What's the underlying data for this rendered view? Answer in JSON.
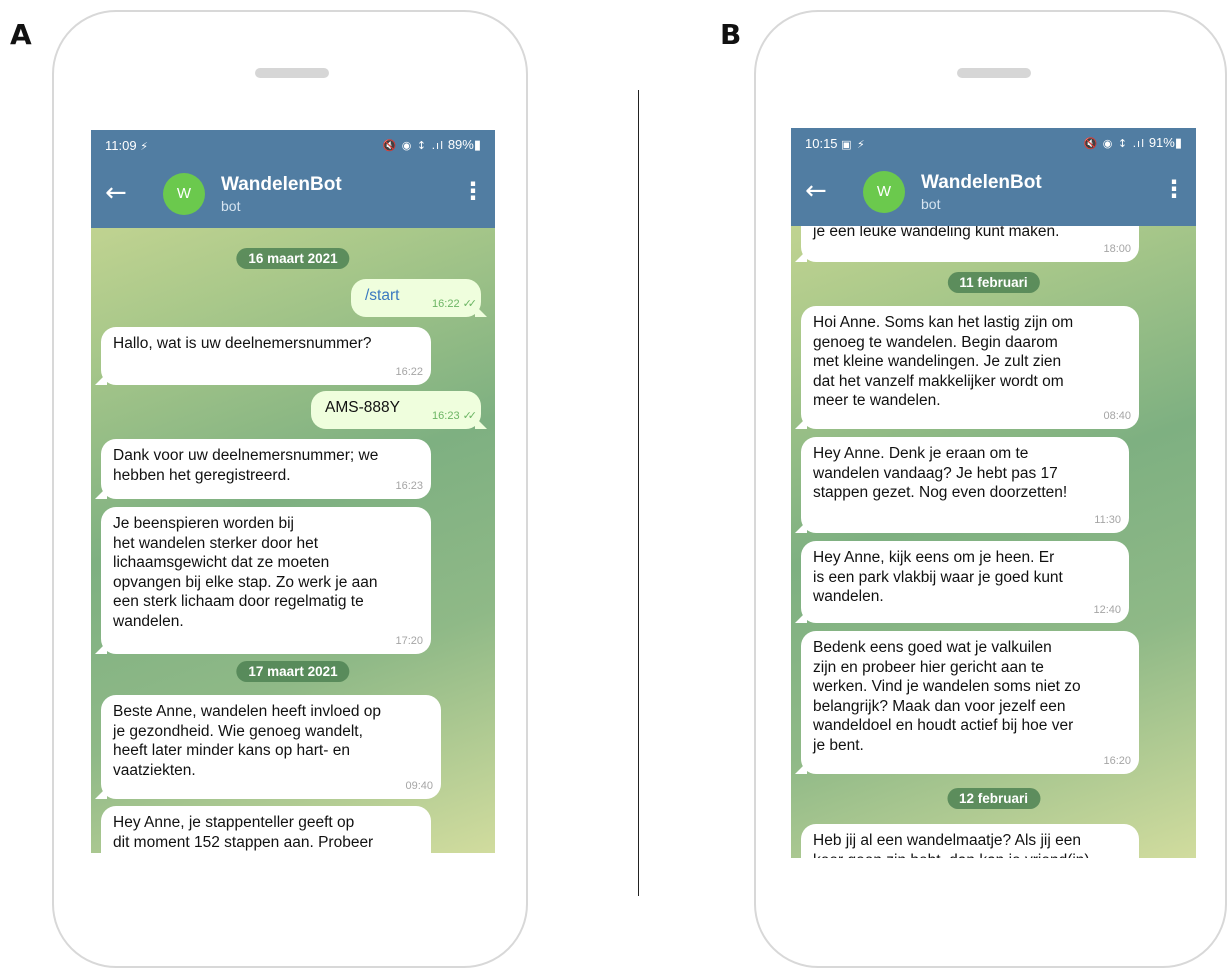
{
  "panel_a": {
    "label": "A",
    "status_time": "11:09",
    "status_extra": "⚡",
    "status_icons": "🔇 ◉ ↕ .ıl",
    "status_battery": "89%▮",
    "chat_title": "WandelenBot",
    "chat_subtitle": "bot",
    "avatar_letter": "W",
    "dates": [
      "16 maart 2021",
      "17 maart 2021"
    ],
    "messages": [
      {
        "text": "/start",
        "time": "16:22",
        "ticks": "✓✓"
      },
      {
        "text": "Hallo, wat is uw deelnemersnummer?",
        "time": "16:22"
      },
      {
        "text": "AMS-888Y",
        "time": "16:23",
        "ticks": "✓✓"
      },
      {
        "text": "Dank voor uw deelnemersnummer; we\nhebben het geregistreerd.",
        "time": "16:23"
      },
      {
        "text": "Je beenspieren worden bij\nhet wandelen sterker door het\nlichaamsgewicht dat ze moeten\nopvangen bij elke stap. Zo werk je aan\neen sterk lichaam door regelmatig te\nwandelen.",
        "time": "17:20"
      },
      {
        "text": "Beste Anne, wandelen heeft invloed op\nje gezondheid. Wie genoeg wandelt,\nheeft later minder kans op hart- en\nvaatziekten.",
        "time": "09:40"
      },
      {
        "text": "Hey Anne, je stappenteller geeft op\ndit moment 152 stappen aan. Probeer",
        "time": ""
      }
    ]
  },
  "panel_b": {
    "label": "B",
    "status_time": "10:15",
    "status_extra": "▣ ⚡",
    "status_icons": "🔇 ◉ ↕ .ıl",
    "status_battery": "91%▮",
    "chat_title": "WandelenBot",
    "chat_subtitle": "bot",
    "avatar_letter": "W",
    "dates": [
      "11 februari",
      "12 februari"
    ],
    "messages": [
      {
        "text": "je een leuke wandeling kunt maken.",
        "time": "18:00"
      },
      {
        "text": "Hoi Anne. Soms kan het lastig zijn om\ngenoeg te wandelen. Begin daarom\nmet kleine wandelingen. Je zult zien\ndat het vanzelf makkelijker wordt om\nmeer te wandelen.",
        "time": "08:40"
      },
      {
        "text": "Hey Anne. Denk je eraan om te\nwandelen vandaag? Je hebt pas 17\nstappen gezet. Nog even doorzetten!",
        "time": "11:30"
      },
      {
        "text": "Hey Anne, kijk eens om je heen. Er\nis een park vlakbij waar je goed kunt\nwandelen.",
        "time": "12:40"
      },
      {
        "text": "Bedenk eens goed wat je valkuilen\nzijn en probeer hier gericht aan te\nwerken. Vind je wandelen soms niet zo\nbelangrijk? Maak dan voor jezelf een\nwandeldoel en houdt actief bij hoe ver\nje bent.",
        "time": "16:20"
      },
      {
        "text": "Heb jij al een wandelmaatje? Als jij een\nkeer geen zin hebt, dan kan je vriend(in)",
        "time": ""
      }
    ]
  },
  "colors": {
    "header": "#517da2",
    "incoming_bubble": "#ffffff",
    "outgoing_bubble": "#effedd",
    "date_pill": "#4f8253",
    "avatar": "#6bc94d",
    "link": "#3a79c0"
  }
}
